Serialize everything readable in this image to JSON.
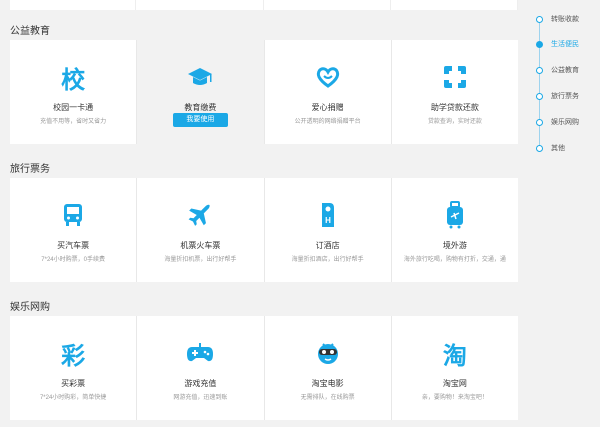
{
  "sections": [
    {
      "title": "公益教育",
      "items": [
        {
          "icon": "school-char-icon",
          "glyph": "校",
          "name": "校园一卡通",
          "desc": "充值不用等，省时又省力"
        },
        {
          "icon": "graduation-cap-icon",
          "name": "教育缴费",
          "desc": "",
          "button": "我要使用",
          "active": true
        },
        {
          "icon": "heart-hands-icon",
          "name": "爱心捐赠",
          "desc": "公开透明的网络捐赠平台"
        },
        {
          "icon": "loan-repay-icon",
          "name": "助学贷款还款",
          "desc": "贷款查询，实时还款"
        }
      ]
    },
    {
      "title": "旅行票务",
      "items": [
        {
          "icon": "bus-icon",
          "name": "买汽车票",
          "desc": "7*24小时购票，0手续费"
        },
        {
          "icon": "airplane-icon",
          "name": "机票火车票",
          "desc": "海量折扣机票，出行好帮手"
        },
        {
          "icon": "hotel-tag-icon",
          "name": "订酒店",
          "desc": "海量折扣酒店，出行好帮手"
        },
        {
          "icon": "luggage-icon",
          "name": "境外游",
          "desc": "海外旅行吃喝，购物有打折，交通，通"
        }
      ]
    },
    {
      "title": "娱乐网购",
      "items": [
        {
          "icon": "lottery-char-icon",
          "glyph": "彩",
          "name": "买彩票",
          "desc": "7*24小时购彩，简单快捷"
        },
        {
          "icon": "gamepad-icon",
          "name": "游戏充值",
          "desc": "网游充值，迅速到账"
        },
        {
          "icon": "movie-face-icon",
          "name": "淘宝电影",
          "desc": "无需排队，在线购票"
        },
        {
          "icon": "taobao-char-icon",
          "glyph": "淘",
          "name": "淘宝网",
          "desc": "亲，要购物！来淘宝吧！"
        }
      ]
    }
  ],
  "nav": [
    {
      "label": "转账收款",
      "active": false
    },
    {
      "label": "生活便民",
      "active": true
    },
    {
      "label": "公益教育",
      "active": false
    },
    {
      "label": "旅行票务",
      "active": false
    },
    {
      "label": "娱乐网购",
      "active": false
    },
    {
      "label": "其他",
      "active": false
    }
  ],
  "colors": {
    "accent": "#1ba8e6",
    "background": "#f2f2f2",
    "card": "#ffffff"
  }
}
